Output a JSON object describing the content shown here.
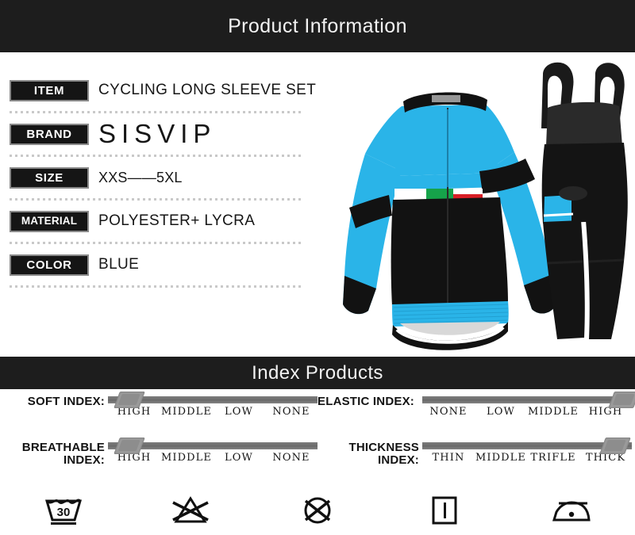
{
  "header": {
    "title": "Product Information"
  },
  "specs": [
    {
      "label": "ITEM",
      "value": "CYCLING LONG SLEEVE SET"
    },
    {
      "label": "BRAND",
      "value": "SISVIP"
    },
    {
      "label": "SIZE",
      "value": "XXS——5XL"
    },
    {
      "label": "MATERIAL",
      "value": "POLYESTER+ LYCRA"
    },
    {
      "label": "COLOR",
      "value": "BLUE"
    }
  ],
  "product_image": {
    "alt": "blue and black cycling long sleeve jersey with bib tights",
    "jersey_blue": "#2ab4e8",
    "jersey_black": "#121212",
    "flag_green": "#16a34a",
    "flag_white": "#ffffff",
    "flag_red": "#d81e26"
  },
  "index_header": {
    "title": "Index Products"
  },
  "indexes": [
    {
      "name": "soft-index",
      "title": "SOFT INDEX:",
      "scale": [
        "HIGH",
        "MIDDLE",
        "LOW",
        "NONE"
      ],
      "selected": "HIGH",
      "thumb_percent": 4
    },
    {
      "name": "elastic-index",
      "title": "ELASTIC INDEX:",
      "scale": [
        "NONE",
        "LOW",
        "MIDDLE",
        "HIGH"
      ],
      "selected": "HIGH",
      "thumb_percent": 90
    },
    {
      "name": "breathable-index",
      "title": "BREATHABLE INDEX:",
      "scale": [
        "HIGH",
        "MIDDLE",
        "LOW",
        "NONE"
      ],
      "selected": "HIGH",
      "thumb_percent": 4
    },
    {
      "name": "thickness-index",
      "title": "THICKNESS INDEX:",
      "scale": [
        "THIN",
        "MIDDLE",
        "TRIFLE",
        "THICK"
      ],
      "selected": "THICK",
      "thumb_percent": 86
    }
  ],
  "care_icons": [
    {
      "name": "wash-30-icon",
      "label": "30",
      "meaning": "machine wash 30 degrees, gentle"
    },
    {
      "name": "do-not-bleach-icon",
      "label": "",
      "meaning": "do not bleach"
    },
    {
      "name": "do-not-tumble-dry-icon",
      "label": "",
      "meaning": "do not tumble dry"
    },
    {
      "name": "drip-dry-icon",
      "label": "",
      "meaning": "drip dry / line dry"
    },
    {
      "name": "iron-low-icon",
      "label": "",
      "meaning": "iron low temperature"
    }
  ],
  "colors": {
    "banner_bg": "#1d1d1d",
    "banner_text": "#f2f2f2",
    "label_bg": "#151515",
    "label_border": "#8a8a8a",
    "track": "#6f6f6f",
    "thumb": "#9a9a9a",
    "dots": "#c9c9c9"
  }
}
